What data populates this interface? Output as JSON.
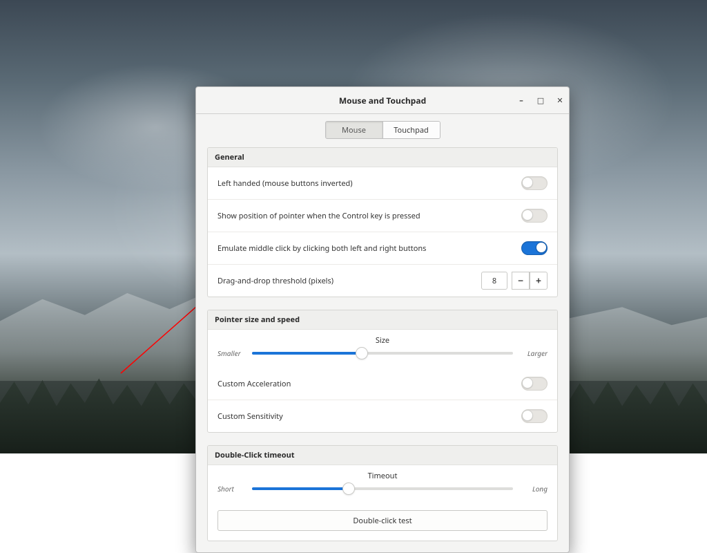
{
  "window": {
    "title": "Mouse and Touchpad"
  },
  "tabs": {
    "mouse": "Mouse",
    "touchpad": "Touchpad",
    "active": "mouse"
  },
  "general": {
    "title": "General",
    "left_handed": {
      "label": "Left handed (mouse buttons inverted)",
      "value": false
    },
    "show_pointer": {
      "label": "Show position of pointer when the Control key is pressed",
      "value": false
    },
    "emulate_middle": {
      "label": "Emulate middle click by clicking both left and right buttons",
      "value": true
    },
    "drag_threshold": {
      "label": "Drag-and-drop threshold (pixels)",
      "value": "8"
    }
  },
  "pointer": {
    "title": "Pointer size and speed",
    "size_label": "Size",
    "size_min": "Smaller",
    "size_max": "Larger",
    "size_value_pct": 42,
    "custom_accel": {
      "label": "Custom Acceleration",
      "value": false
    },
    "custom_sens": {
      "label": "Custom Sensitivity",
      "value": false
    }
  },
  "dclick": {
    "title": "Double-Click timeout",
    "timeout_label": "Timeout",
    "timeout_min": "Short",
    "timeout_max": "Long",
    "timeout_value_pct": 37,
    "test_button": "Double-click test"
  },
  "colors": {
    "accent": "#1b74d8"
  },
  "annotation": {
    "type": "arrow",
    "description": "Red arrow pointing from lower-left area to the Touchpad tab",
    "color": "#ff0000"
  }
}
